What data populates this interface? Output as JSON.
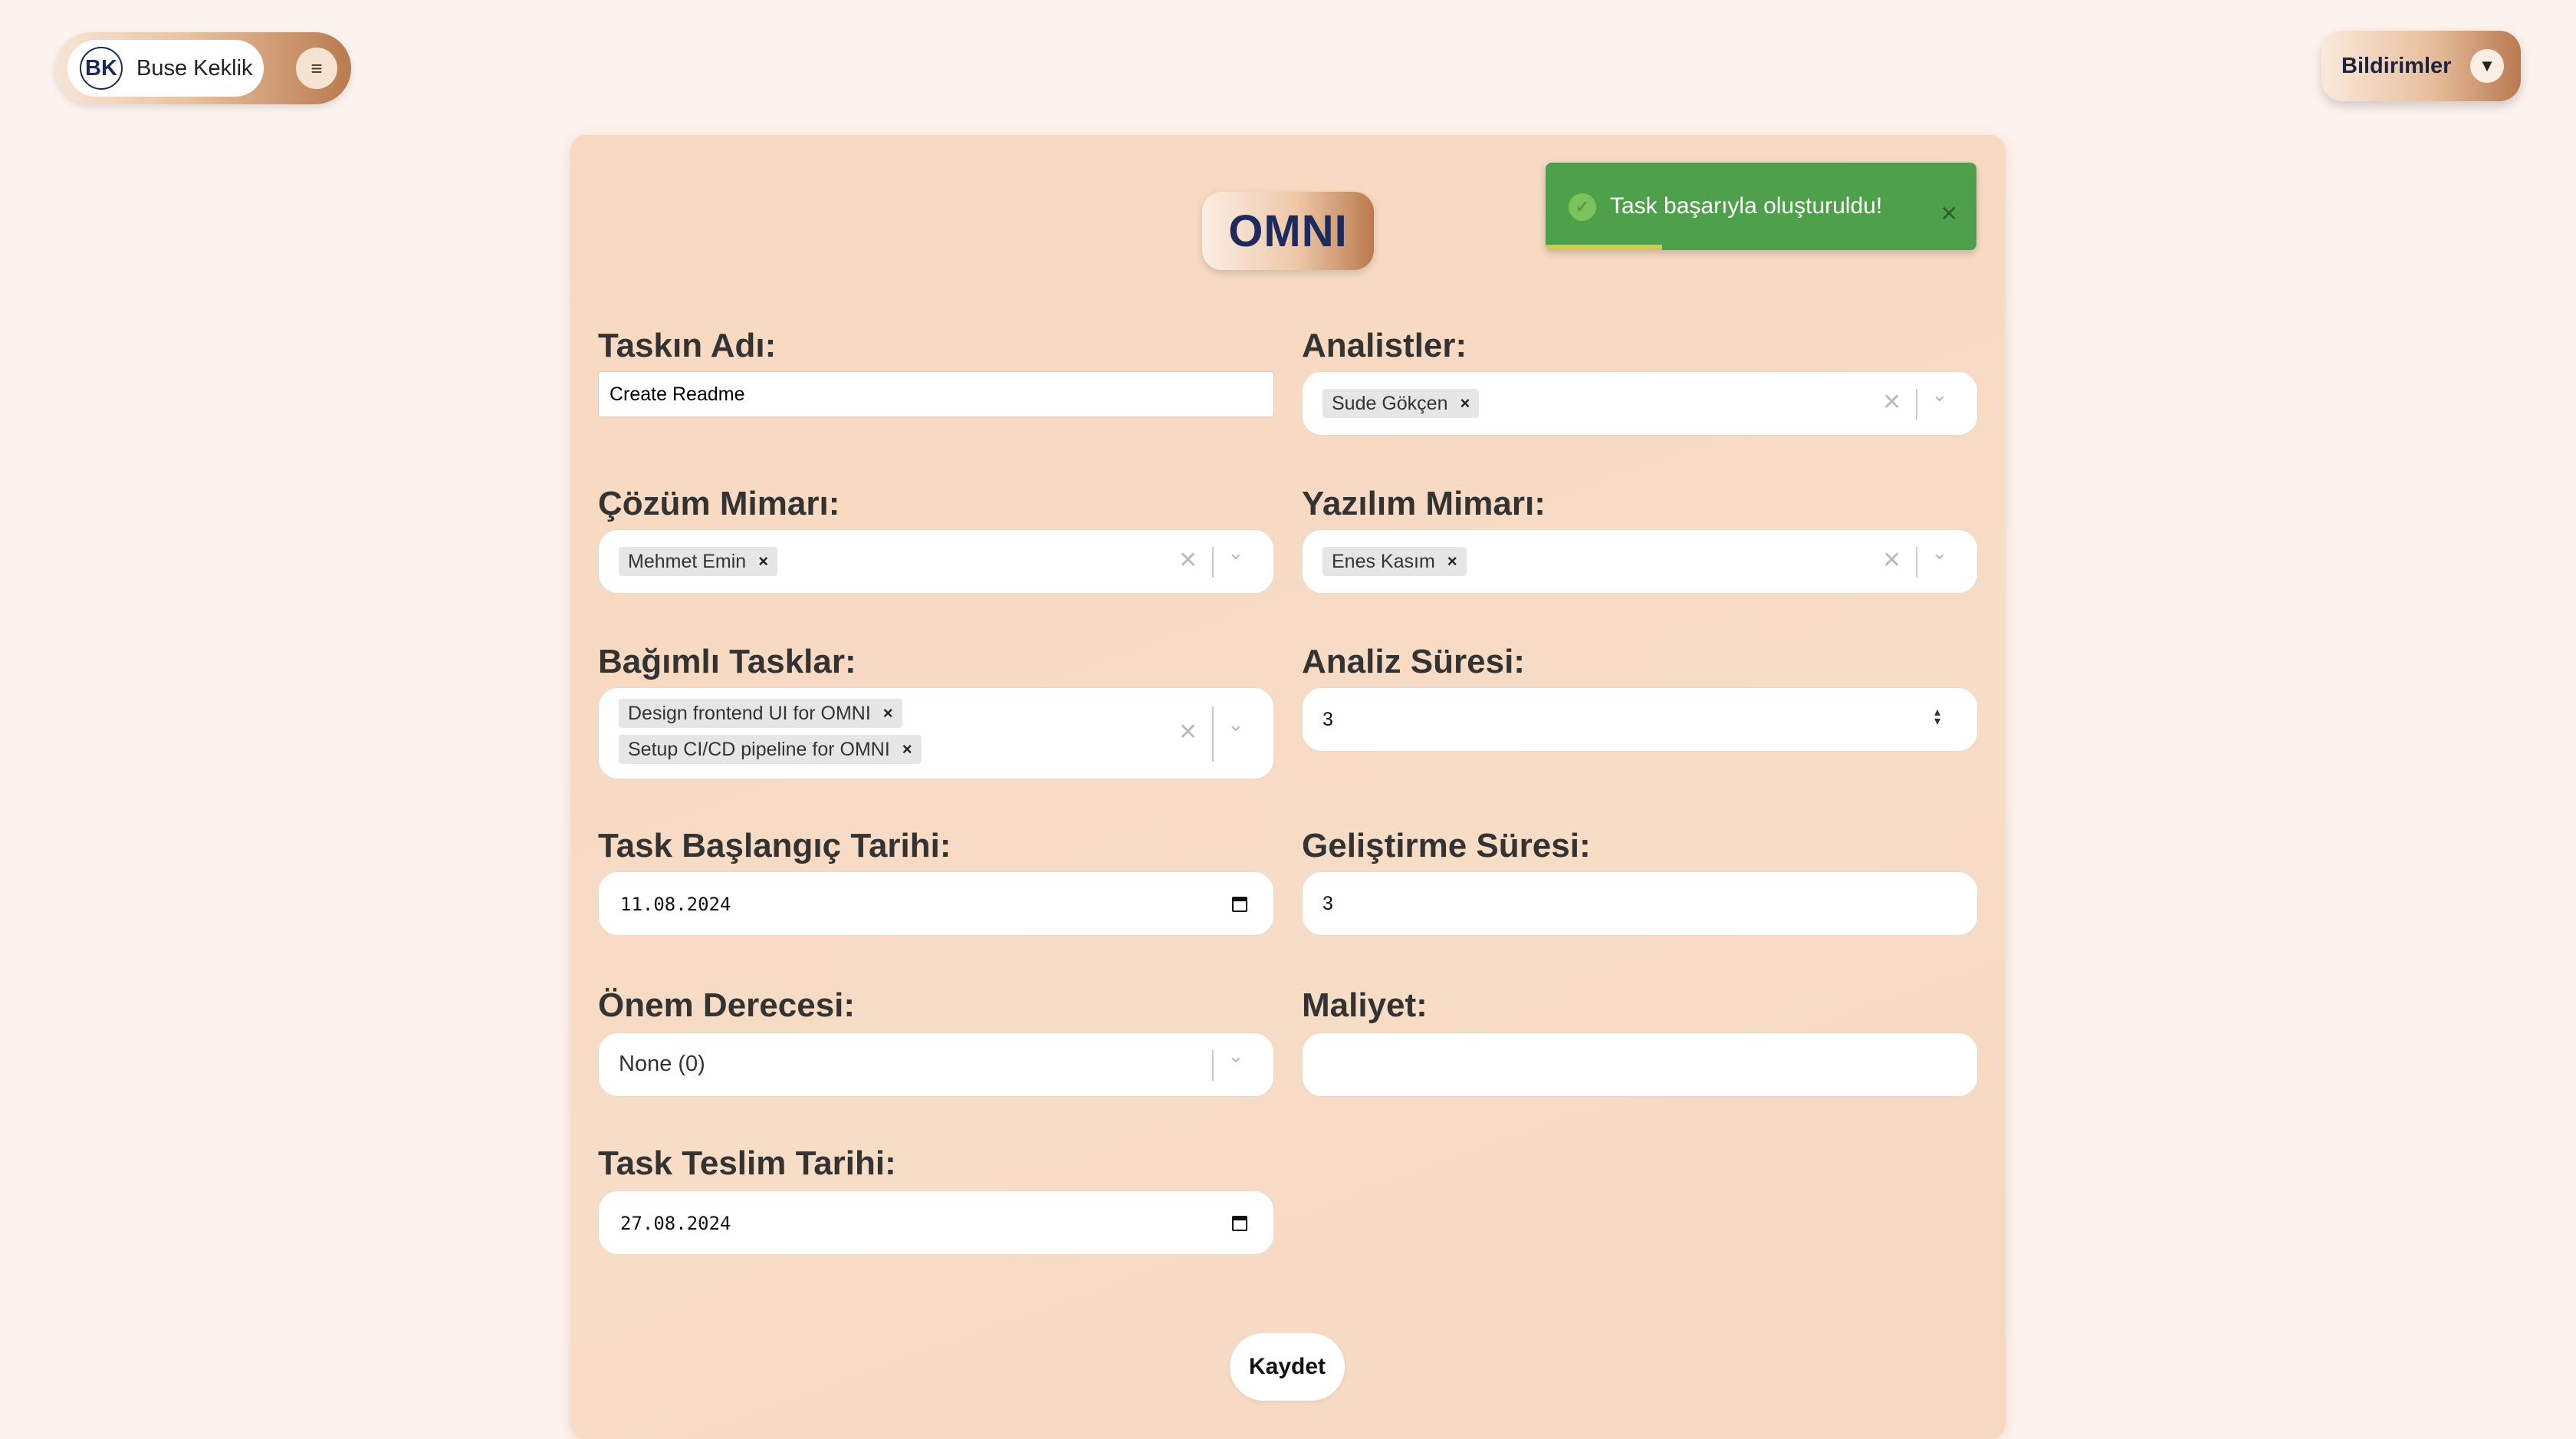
{
  "user": {
    "initials": "BK",
    "name": "Buse Keklik",
    "menu_icon": "≡"
  },
  "notifications": {
    "label": "Bildirimler",
    "arrow": "▼"
  },
  "app": {
    "title": "OMNI"
  },
  "toast": {
    "message": "Task başarıyla oluşturuldu!",
    "close": "✕",
    "icon": "✓",
    "progress": 0.27
  },
  "form": {
    "task_name": {
      "label": "Taskın Adı:",
      "value": "Create Readme"
    },
    "analysts": {
      "label": "Analistler:",
      "tags": [
        "Sude Gökçen"
      ]
    },
    "solution_architect": {
      "label": "Çözüm Mimarı:",
      "tags": [
        "Mehmet Emin"
      ]
    },
    "software_architect": {
      "label": "Yazılım Mimarı:",
      "tags": [
        "Enes Kasım"
      ]
    },
    "dependent_tasks": {
      "label": "Bağımlı Tasklar:",
      "tags": [
        "Design frontend UI for OMNI",
        "Setup CI/CD pipeline for OMNI"
      ]
    },
    "analysis_duration": {
      "label": "Analiz Süresi:",
      "value": "3"
    },
    "start_date": {
      "label": "Task Başlangıç Tarihi:",
      "value": "11.08.2024"
    },
    "dev_duration": {
      "label": "Geliştirme Süresi:",
      "value": "3"
    },
    "priority": {
      "label": "Önem Derecesi:",
      "value": "None (0)"
    },
    "cost": {
      "label": "Maliyet:",
      "value": ""
    },
    "due_date": {
      "label": "Task Teslim Tarihi:",
      "value": "27.08.2024"
    },
    "tag_remove": "×",
    "clear_icon": "✕",
    "chevron": "⌄"
  },
  "save_button": "Kaydet"
}
